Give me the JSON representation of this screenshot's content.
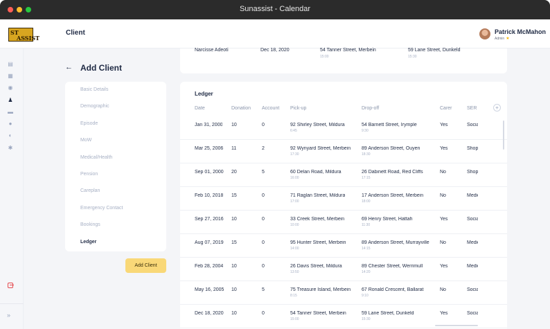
{
  "window": {
    "title": "Sunassist - Calendar"
  },
  "brand": {
    "logo_text_1": "ST",
    "logo_text_2": "ASSIST"
  },
  "header": {
    "title": "Client"
  },
  "user": {
    "name": "Patrick McMahon",
    "role": "Admin"
  },
  "page": {
    "title": "Add Client"
  },
  "steps": [
    "Basic Details",
    "Demographic",
    "Episode",
    "MoW",
    "Medical/Health",
    "Pension",
    "Careplan",
    "Emergency Contact",
    "Bookings",
    "Ledger"
  ],
  "active_step": "Ledger",
  "add_button_label": "Add Client",
  "top_row": {
    "name": "Narcisse Adeoti",
    "date": "Dec 18, 2020",
    "pickup": "54 Tanner Street, Merbein",
    "pickup_time": "15:00",
    "dropoff": "59 Lane Street, Dunkeld",
    "dropoff_time": "15:30"
  },
  "ledger": {
    "title": "Ledger",
    "columns": [
      "Date",
      "Donation",
      "Account",
      "Pick-up",
      "Drop-off",
      "Carer",
      "SER"
    ],
    "rows": [
      {
        "date": "Jan 31, 2000",
        "donation": "10",
        "account": "0",
        "pickup": "92 Shirley Street, Mildura",
        "pickup_time": "6:45",
        "dropoff": "54 Barnett Street, Irymple",
        "dropoff_time": "9:30",
        "carer": "Yes",
        "ser": "Social"
      },
      {
        "date": "Mar 25, 2006",
        "donation": "11",
        "account": "2",
        "pickup": "92 Wynyard Street, Merbein",
        "pickup_time": "17:30",
        "dropoff": "89 Anderson Street, Ouyen",
        "dropoff_time": "18:30",
        "carer": "Yes",
        "ser": "Shopping"
      },
      {
        "date": "Sep 01, 2000",
        "donation": "20",
        "account": "5",
        "pickup": "60 Delan Road, Mildura",
        "pickup_time": "16:00",
        "dropoff": "26 Dabinett Road, Red Cliffs",
        "dropoff_time": "17:15",
        "carer": "No",
        "ser": "Shopping"
      },
      {
        "date": "Feb 10, 2018",
        "donation": "15",
        "account": "0",
        "pickup": "71 Raglan Street, Mildura",
        "pickup_time": "17:00",
        "dropoff": "17 Anderson Street, Merbein",
        "dropoff_time": "18:00",
        "carer": "No",
        "ser": "Medical"
      },
      {
        "date": "Sep 27, 2016",
        "donation": "10",
        "account": "0",
        "pickup": "33 Creek Street, Merbein",
        "pickup_time": "10:00",
        "dropoff": "69 Henry Street, Hattah",
        "dropoff_time": "11:30",
        "carer": "Yes",
        "ser": "Social"
      },
      {
        "date": "Aug 07, 2019",
        "donation": "15",
        "account": "0",
        "pickup": "95 Hunter Street, Merbein",
        "pickup_time": "14:00",
        "dropoff": "89 Anderson Street, Murrayville",
        "dropoff_time": "14:15",
        "carer": "No",
        "ser": "Medical"
      },
      {
        "date": "Feb 28, 2004",
        "donation": "10",
        "account": "0",
        "pickup": "26 Davis Street, Mildura",
        "pickup_time": "13:50",
        "dropoff": "89 Chester Street, Werrimull",
        "dropoff_time": "14:20",
        "carer": "Yes",
        "ser": "Medical"
      },
      {
        "date": "May 16, 2005",
        "donation": "10",
        "account": "5",
        "pickup": "75 Treasure Island, Merbein",
        "pickup_time": "8:15",
        "dropoff": "67 Ronald Crescent, Ballarat",
        "dropoff_time": "9:10",
        "carer": "No",
        "ser": "Social"
      },
      {
        "date": "Dec 18, 2020",
        "donation": "10",
        "account": "0",
        "pickup": "54 Tanner Street, Merbein",
        "pickup_time": "15:00",
        "dropoff": "59 Lane Street, Dunkeld",
        "dropoff_time": "15:30",
        "carer": "Yes",
        "ser": "Social"
      }
    ]
  }
}
